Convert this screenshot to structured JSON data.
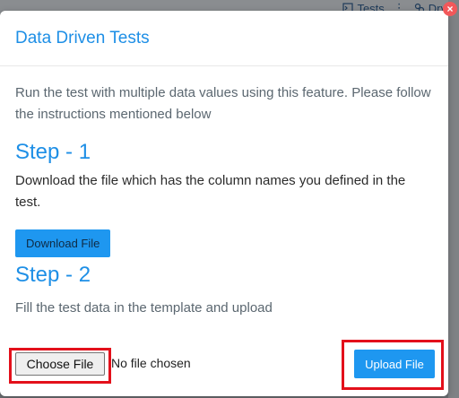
{
  "background": {
    "toolbar": {
      "tests_label": "Tests",
      "dry_label": "Dry",
      "more_label": "⋮"
    }
  },
  "modal": {
    "title": "Data Driven Tests",
    "close_label": "×",
    "intro": "Run the test with multiple data values using this feature. Please follow the instructions mentioned below",
    "step1": {
      "title": "Step - 1",
      "description": "Download the file which has the column names you defined in the test.",
      "download_label": "Download File"
    },
    "step2": {
      "title": "Step - 2",
      "description": "Fill the test data in the template and upload"
    },
    "file_input": {
      "choose_label": "Choose File",
      "status": "No file chosen"
    },
    "upload_label": "Upload File"
  },
  "colors": {
    "accent": "#1e8fe6",
    "button": "#1e97f0",
    "highlight": "#e3101b",
    "close": "#f2585a"
  }
}
